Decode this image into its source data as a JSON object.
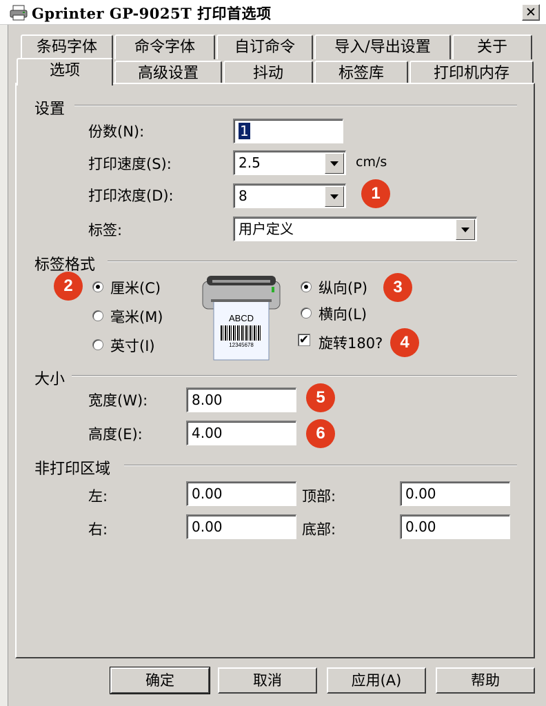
{
  "window": {
    "title": "Gprinter GP-9025T 打印首选项",
    "close_label": "✕"
  },
  "tabs": {
    "back_row": [
      "条码字体",
      "命令字体",
      "自订命令",
      "导入/导出设置",
      "关于"
    ],
    "front_row": [
      "选项",
      "高级设置",
      "抖动",
      "标签库",
      "打印机内存"
    ],
    "active": "选项"
  },
  "settings": {
    "legend": "设置",
    "copies_label": "份数(N):",
    "copies_value": "1",
    "speed_label": "打印速度(S):",
    "speed_value": "2.5",
    "speed_unit": "cm/s",
    "density_label": "打印浓度(D):",
    "density_value": "8",
    "label_label": "标签:",
    "label_value": "用户定义"
  },
  "label_format": {
    "legend": "标签格式",
    "units": [
      {
        "label": "厘米(C)",
        "selected": true
      },
      {
        "label": "毫米(M)",
        "selected": false
      },
      {
        "label": "英寸(I)",
        "selected": false
      }
    ],
    "orientation": [
      {
        "label": "纵向(P)",
        "selected": true
      },
      {
        "label": "横向(L)",
        "selected": false
      }
    ],
    "rotate_label": "旋转180?",
    "rotate_checked": true,
    "preview_text": "ABCD",
    "preview_code": "12345678"
  },
  "size": {
    "legend": "大小",
    "width_label": "宽度(W):",
    "width_value": "8.00",
    "height_label": "高度(E):",
    "height_value": "4.00"
  },
  "non_print_area": {
    "legend": "非打印区域",
    "left_label": "左:",
    "left_value": "0.00",
    "top_label": "顶部:",
    "top_value": "0.00",
    "right_label": "右:",
    "right_value": "0.00",
    "bottom_label": "底部:",
    "bottom_value": "0.00"
  },
  "badges": [
    "1",
    "2",
    "3",
    "4",
    "5",
    "6"
  ],
  "buttons": {
    "ok": "确定",
    "cancel": "取消",
    "apply": "应用(A)",
    "help": "帮助"
  },
  "colors": {
    "badge": "#e13b1d",
    "dialog_bg": "#d6d3ce",
    "selection": "#0a246a"
  }
}
